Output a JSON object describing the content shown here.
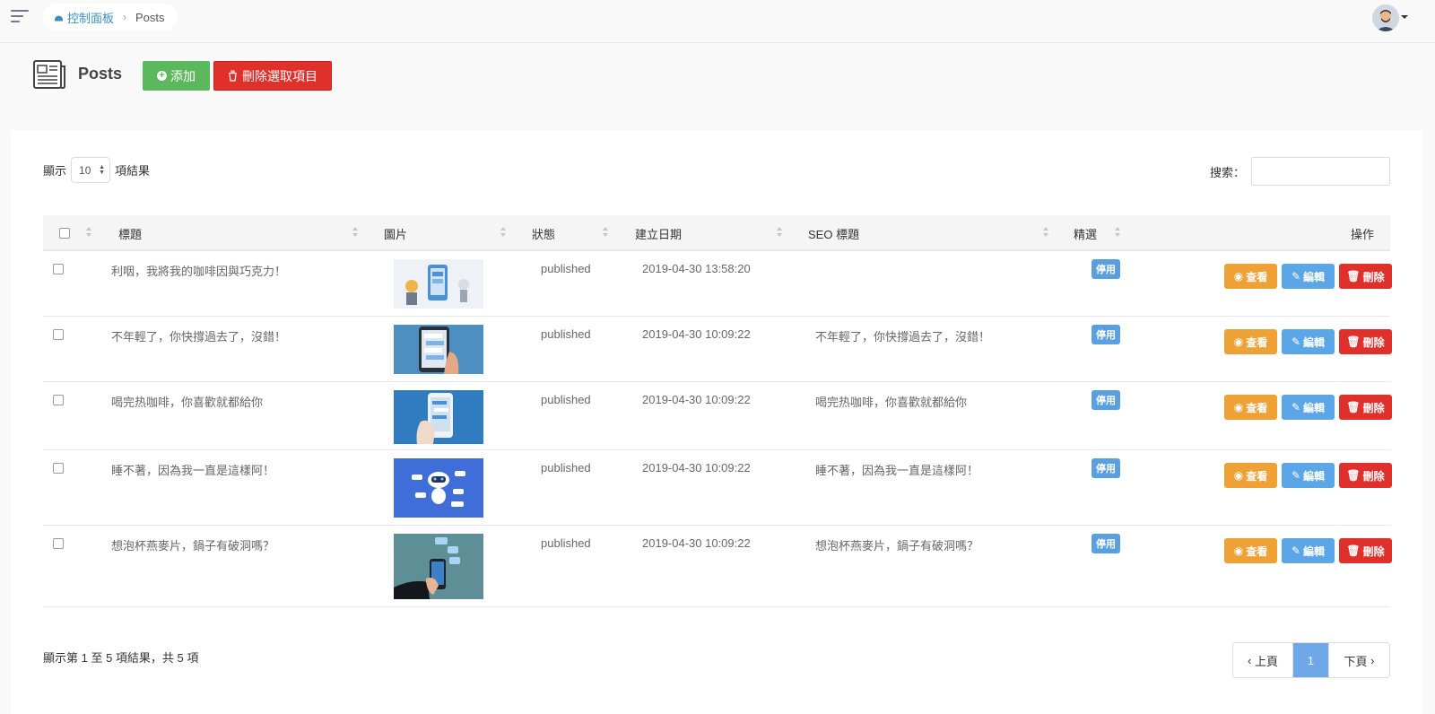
{
  "topbar": {
    "breadcrumb_home": "控制面板",
    "breadcrumb_current": "Posts"
  },
  "header": {
    "title": "Posts",
    "add_label": "添加",
    "delete_selected_label": "刪除選取項目"
  },
  "table_controls": {
    "show_label": "顯示",
    "page_length": "10",
    "results_label": "項結果",
    "search_label": "搜索："
  },
  "columns": {
    "title": "標題",
    "image": "圖片",
    "status": "狀態",
    "created": "建立日期",
    "seo": "SEO 標題",
    "featured": "精選",
    "actions": "操作"
  },
  "rows": [
    {
      "title": "利咽，我將我的咖啡因與巧克力！",
      "status": "published",
      "created": "2019-04-30 13:58:20",
      "seo": "",
      "featured": "停用",
      "image": "robot-phone-illustration"
    },
    {
      "title": "不年輕了，你快撐過去了，沒錯！",
      "status": "published",
      "created": "2019-04-30 10:09:22",
      "seo": "不年輕了，你快撐過去了，沒錯！",
      "featured": "停用",
      "image": "phone-chat-photo"
    },
    {
      "title": "喝完热咖啡，你喜歡就都給你",
      "status": "published",
      "created": "2019-04-30 10:09:22",
      "seo": "喝完热咖啡，你喜歡就都給你",
      "featured": "停用",
      "image": "hand-phone-blue"
    },
    {
      "title": "睡不著，因為我一直是這樣阿！",
      "status": "published",
      "created": "2019-04-30 10:09:22",
      "seo": "睡不著，因為我一直是這樣阿！",
      "featured": "停用",
      "image": "chatbot-robot"
    },
    {
      "title": "想泡杯燕麥片，鍋子有破洞嗎？",
      "status": "published",
      "created": "2019-04-30 10:09:22",
      "seo": "想泡杯燕麥片，鍋子有破洞嗎？",
      "featured": "停用",
      "image": "hand-phone-chat"
    }
  ],
  "actions": {
    "view": "查看",
    "edit": "編輯",
    "delete": "刪除"
  },
  "footer": {
    "info": "顯示第 1 至 5 項結果，共 5 項",
    "prev": "上頁",
    "current_page": "1",
    "next": "下頁"
  },
  "colors": {
    "add": "#5cb85c",
    "delete": "#e0302b",
    "view": "#eea236",
    "edit": "#5ba6e6",
    "badge": "#5a9fe0"
  }
}
